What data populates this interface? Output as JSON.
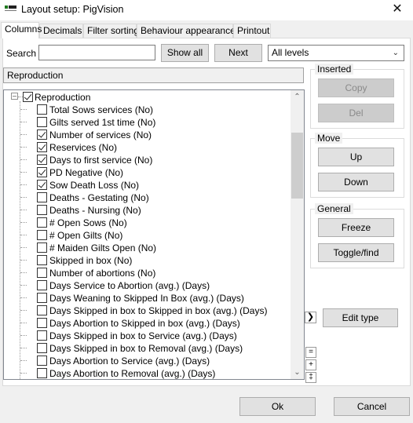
{
  "window": {
    "title": "Layout setup: PigVision",
    "close_glyph": "✕"
  },
  "tabs": [
    {
      "label": "Columns",
      "active": true
    },
    {
      "label": "Decimals",
      "active": false
    },
    {
      "label": "Filter sorting",
      "active": false
    },
    {
      "label": "Behaviour  appearance",
      "active": false
    },
    {
      "label": "Printout",
      "active": false
    }
  ],
  "toolbar": {
    "search_label": "Search",
    "search_value": "",
    "show_all_label": "Show all",
    "next_label": "Next",
    "levels_value": "All levels"
  },
  "breadcrumb": "Reproduction",
  "tree": {
    "root": {
      "label": "Reproduction",
      "checked": true,
      "expanded": true
    },
    "items": [
      {
        "label": "Total Sows services (No)",
        "checked": false
      },
      {
        "label": "Gilts served 1st time (No)",
        "checked": false
      },
      {
        "label": "Number of services (No)",
        "checked": true
      },
      {
        "label": "Reservices (No)",
        "checked": true
      },
      {
        "label": "Days to first service (No)",
        "checked": true
      },
      {
        "label": "PD Negative (No)",
        "checked": true
      },
      {
        "label": "Sow Death Loss (No)",
        "checked": true
      },
      {
        "label": "Deaths - Gestating (No)",
        "checked": false
      },
      {
        "label": "Deaths - Nursing (No)",
        "checked": false
      },
      {
        "label": "# Open Sows (No)",
        "checked": false
      },
      {
        "label": "# Open Gilts (No)",
        "checked": false
      },
      {
        "label": "# Maiden Gilts Open (No)",
        "checked": false
      },
      {
        "label": "Skipped in box (No)",
        "checked": false
      },
      {
        "label": "Number of abortions (No)",
        "checked": false
      },
      {
        "label": "Days Service to Abortion (avg.) (Days)",
        "checked": false
      },
      {
        "label": "Days Weaning to Skipped In Box (avg.) (Days)",
        "checked": false
      },
      {
        "label": "Days Skipped in box to Skipped in box (avg.) (Days)",
        "checked": false
      },
      {
        "label": "Days Abortion to Skipped in box (avg.) (Days)",
        "checked": false
      },
      {
        "label": "Days Skipped in box to Service (avg.) (Days)",
        "checked": false
      },
      {
        "label": "Days Skipped in box to Removal (avg.) (Days)",
        "checked": false
      },
      {
        "label": "Days Abortion to Service (avg.) (Days)",
        "checked": false
      },
      {
        "label": "Days Abortion to Removal (avg.) (Days)",
        "checked": false
      }
    ]
  },
  "inserted_group": {
    "title": "Inserted",
    "copy_label": "Copy",
    "del_label": "Del"
  },
  "move_group": {
    "title": "Move",
    "up_label": "Up",
    "down_label": "Down"
  },
  "general_group": {
    "title": "General",
    "freeze_label": "Freeze",
    "toggle_label": "Toggle/find"
  },
  "edit_type_label": "Edit type",
  "expand_glyph": "❯",
  "tree_tools": {
    "collapse_glyph": "=",
    "expand_glyph": "+",
    "expand_all_glyph": "‡"
  },
  "footer": {
    "ok_label": "Ok",
    "cancel_label": "Cancel"
  },
  "icons": [
    "app-icon",
    "close-icon",
    "dropdown-arrow-icon",
    "collapse-icon",
    "scroll-up-icon",
    "scroll-down-icon"
  ]
}
